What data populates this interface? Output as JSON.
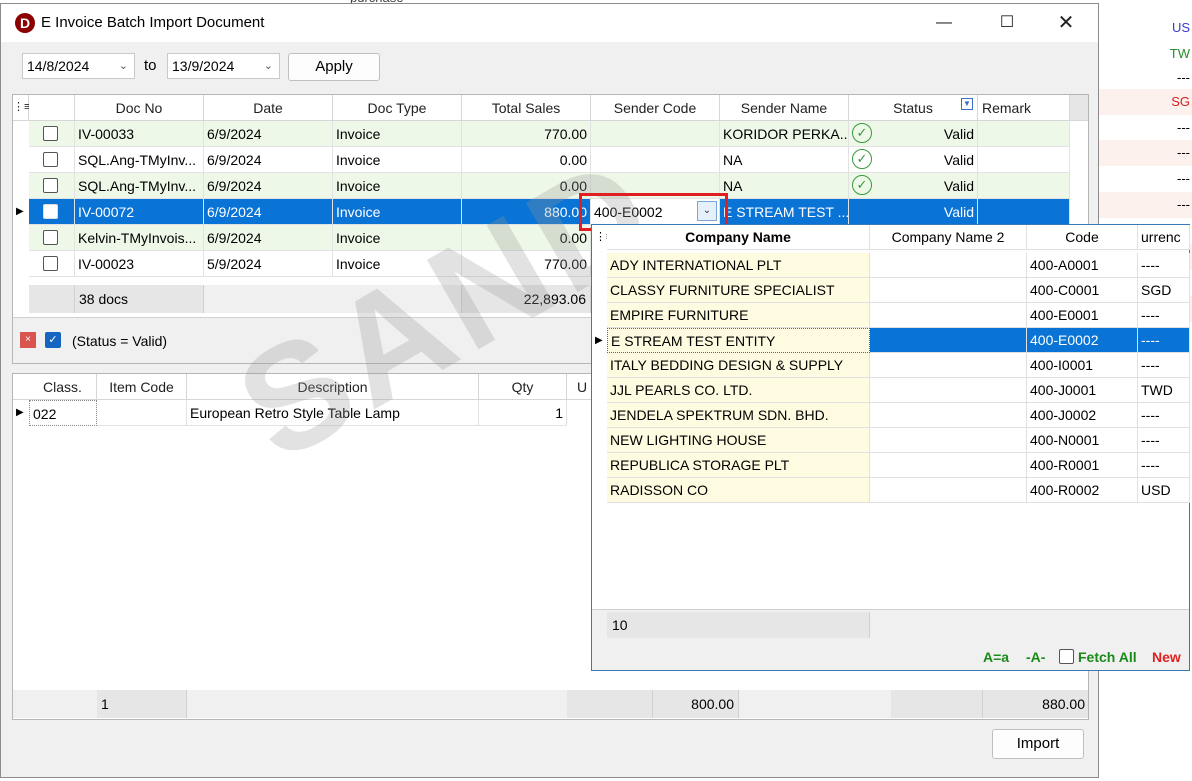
{
  "window": {
    "title": "E Invoice Batch Import Document",
    "logo": "D"
  },
  "filter": {
    "from_date": "14/8/2024",
    "to_label": "to",
    "to_date": "13/9/2024",
    "apply_label": "Apply"
  },
  "doc_grid": {
    "columns": [
      "Doc No",
      "Date",
      "Doc Type",
      "Total Sales",
      "Sender Code",
      "Sender Name",
      "Status",
      "Remark"
    ],
    "rows": [
      {
        "doc_no": "IV-00033",
        "date": "6/9/2024",
        "doc_type": "Invoice",
        "total": "770.00",
        "sender_code": "",
        "sender_name": "KORIDOR PERKA...",
        "status": "Valid"
      },
      {
        "doc_no": "SQL.Ang-TMyInv...",
        "date": "6/9/2024",
        "doc_type": "Invoice",
        "total": "0.00",
        "sender_code": "",
        "sender_name": "NA",
        "status": "Valid"
      },
      {
        "doc_no": "SQL.Ang-TMyInv...",
        "date": "6/9/2024",
        "doc_type": "Invoice",
        "total": "0.00",
        "sender_code": "",
        "sender_name": "NA",
        "status": "Valid"
      },
      {
        "doc_no": "IV-00072",
        "date": "6/9/2024",
        "doc_type": "Invoice",
        "total": "880.00",
        "sender_code": "400-E0002",
        "sender_name": "E STREAM TEST ...",
        "status": "Valid"
      },
      {
        "doc_no": "Kelvin-TMyInvois...",
        "date": "6/9/2024",
        "doc_type": "Invoice",
        "total": "0.00",
        "sender_code": "",
        "sender_name": "",
        "status": ""
      },
      {
        "doc_no": "IV-00023",
        "date": "5/9/2024",
        "doc_type": "Invoice",
        "total": "770.00",
        "sender_code": "",
        "sender_name": "",
        "status": ""
      }
    ],
    "footer_count": "38 docs",
    "footer_total": "22,893.06"
  },
  "filter_bar": {
    "text": "(Status = Valid)"
  },
  "detail_grid": {
    "columns": [
      "Class.",
      "Item Code",
      "Description",
      "Qty",
      "U"
    ],
    "rows": [
      {
        "class": "022",
        "item_code": "",
        "description": "European Retro Style Table Lamp",
        "qty": "1"
      }
    ],
    "footer_count": "1",
    "footer_sub": "800.00",
    "footer_total": "880.00"
  },
  "import_label": "Import",
  "watermark": "SAND",
  "lookup": {
    "columns": [
      "Company Name",
      "Company Name 2",
      "Code",
      "urrenc"
    ],
    "rows": [
      {
        "name": "ADY INTERNATIONAL PLT",
        "name2": "",
        "code": "400-A0001",
        "cur": "----"
      },
      {
        "name": "CLASSY FURNITURE SPECIALIST",
        "name2": "",
        "code": "400-C0001",
        "cur": "SGD"
      },
      {
        "name": "EMPIRE FURNITURE",
        "name2": "",
        "code": "400-E0001",
        "cur": "----"
      },
      {
        "name": "E STREAM TEST ENTITY",
        "name2": "",
        "code": "400-E0002",
        "cur": "----"
      },
      {
        "name": "ITALY BEDDING DESIGN & SUPPLY",
        "name2": "",
        "code": "400-I0001",
        "cur": "----"
      },
      {
        "name": "JJL PEARLS CO. LTD.",
        "name2": "",
        "code": "400-J0001",
        "cur": "TWD"
      },
      {
        "name": "JENDELA SPEKTRUM SDN. BHD.",
        "name2": "",
        "code": "400-J0002",
        "cur": "----"
      },
      {
        "name": "NEW LIGHTING HOUSE",
        "name2": "",
        "code": "400-N0001",
        "cur": "----"
      },
      {
        "name": "REPUBLICA STORAGE PLT",
        "name2": "",
        "code": "400-R0001",
        "cur": "----"
      },
      {
        "name": "RADISSON CO",
        "name2": "",
        "code": "400-R0002",
        "cur": "USD"
      }
    ],
    "footer_count": "10",
    "opt_case": "A=a",
    "opt_dash": "-A-",
    "opt_fetch": "Fetch All",
    "opt_new": "New"
  },
  "background": {
    "lines": [
      "US",
      "TW",
      "---",
      "SG",
      "---",
      "---",
      "---",
      "---",
      "---",
      "---",
      "---",
      "---"
    ],
    "top_text": "purchase"
  },
  "colors": {
    "selection": "#0a74d6",
    "valid_row": "#edf8e8",
    "highlight_border": "#e02020",
    "link_green": "#1a8a1a",
    "link_red": "#e02020"
  }
}
